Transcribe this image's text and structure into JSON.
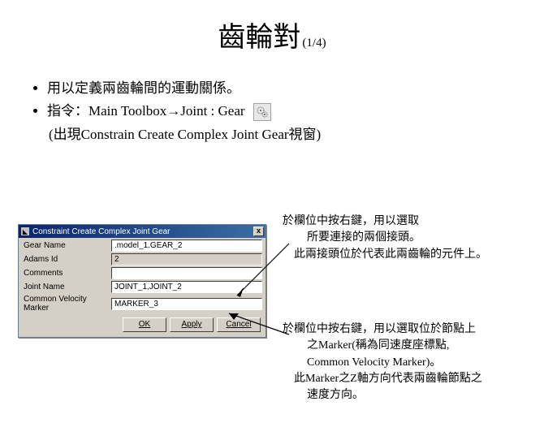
{
  "title": {
    "main": "齒輪對",
    "sub": "(1/4)"
  },
  "bullets": {
    "b1": "用以定義兩齒輪間的運動關係。",
    "b2_pre": "指令：",
    "b2_path": "Main Toolbox→Joint : Gear",
    "b2_paren": "(出現Constrain Create Complex Joint Gear視窗)"
  },
  "dialog": {
    "title": "Constraint Create Complex Joint Gear",
    "close": "x",
    "rows": {
      "gear_name_label": "Gear Name",
      "gear_name_value": ".model_1.GEAR_2",
      "adams_id_label": "Adams Id",
      "adams_id_value": "2",
      "comments_label": "Comments",
      "comments_value": "",
      "joint_name_label": "Joint Name",
      "joint_name_value": "JOINT_1,JOINT_2",
      "cvm_label": "Common Velocity Marker",
      "cvm_value": "MARKER_3"
    },
    "buttons": {
      "ok": "OK",
      "apply": "Apply",
      "cancel": "Cancel"
    }
  },
  "annotations": {
    "a1_l1": "於欄位中按右鍵，用以選取",
    "a1_l2": "所要連接的兩個接頭。",
    "a1_l3": "此兩接頭位於代表此兩齒輪的元件上。",
    "a2_l1": "於欄位中按右鍵，用以選取位於節點上",
    "a2_l2": "之Marker(稱為同速度座標點,",
    "a2_l3": "Common Velocity Marker)。",
    "a2_l4": "此Marker之Z軸方向代表兩齒輪節點之",
    "a2_l5": "速度方向。"
  }
}
